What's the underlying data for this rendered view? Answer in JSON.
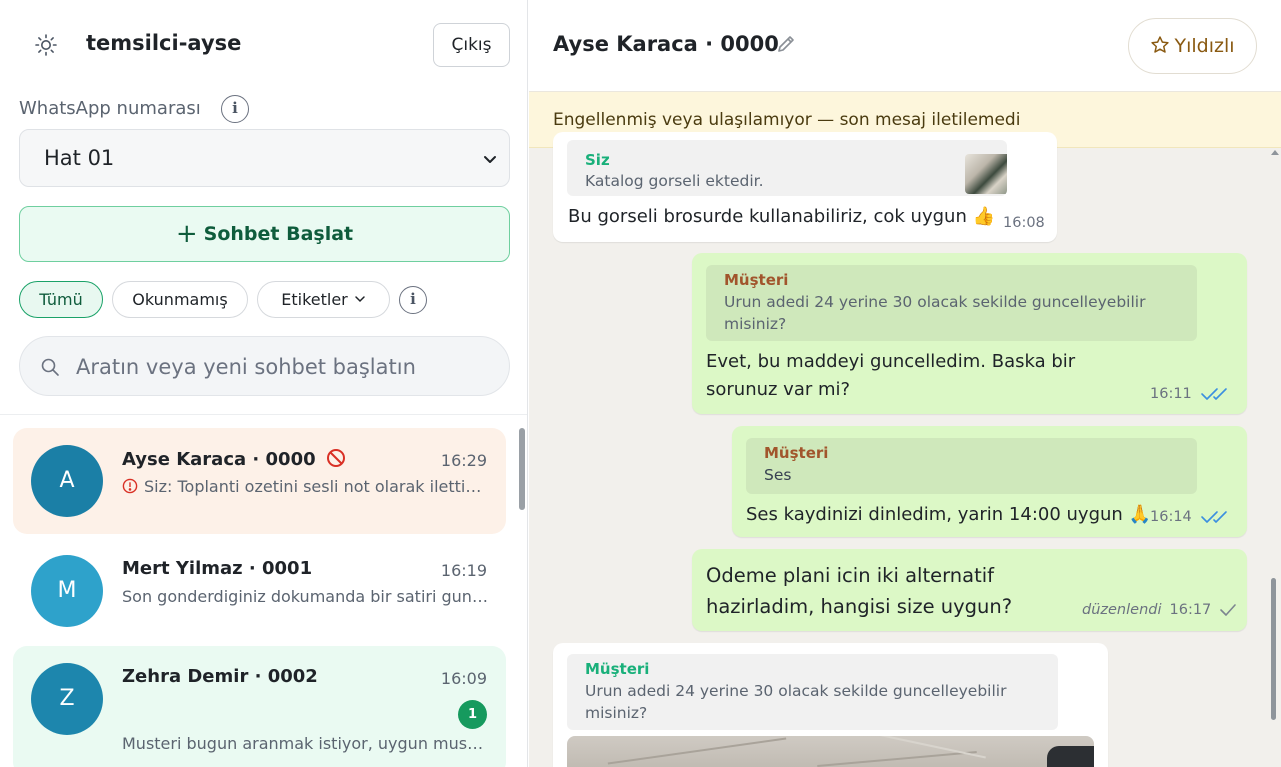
{
  "sidebar": {
    "agent_name": "temsilci-ayse",
    "logout_label": "Çıkış",
    "number_label": "WhatsApp numarası",
    "number_value": "Hat 01",
    "start_chat_label": "Sohbet Başlat",
    "filters": [
      {
        "label": "Tümü",
        "active": true
      },
      {
        "label": "Okunmamış",
        "active": false
      },
      {
        "label": "Etiketler",
        "active": false
      }
    ],
    "search_placeholder": "Aratın veya yeni sohbet başlatın",
    "conversations": [
      {
        "initial": "A",
        "name": "Ayse Karaca · 0000",
        "time": "16:29",
        "preview": "Siz: Toplanti ozetini sesli not olarak ilettim, dinleyebilir misiniz?",
        "blocked": true,
        "failed": true,
        "avatar_color": "#1b7fa6",
        "bg": "#fdf1e8"
      },
      {
        "initial": "M",
        "name": "Mert Yilmaz · 0001",
        "time": "16:19",
        "preview": "Son gonderdiginiz dokumanda bir satiri guncelleyebilir misiniz?",
        "avatar_color": "#2ea2cb",
        "bg": "#ffffff"
      },
      {
        "initial": "Z",
        "name": "Zehra Demir · 0002",
        "time": "16:09",
        "preview": "Musteri bugun aranmak istiyor, uygun musunuz?",
        "unread": "1",
        "avatar_color": "#1d86ad",
        "bg": "#eafaf2"
      }
    ]
  },
  "chat": {
    "title": "Ayse Karaca · 0000",
    "star_label": "Yıldızlı",
    "banner": "Engellenmiş veya ulaşılamıyor — son mesaj iletilemedi",
    "messages": [
      {
        "dir": "in",
        "quote_name": "Siz",
        "quote_text": "Katalog gorseli ektedir.",
        "text": "Bu gorseli brosurde kullanabiliriz, cok uygun 👍",
        "time": "16:08"
      },
      {
        "dir": "out",
        "quote_name": "Müşteri",
        "quote_text": "Urun adedi 24 yerine 30 olacak sekilde guncelleyebilir misiniz?",
        "text": "Evet, bu maddeyi guncelledim. Baska bir sorunuz var mi?",
        "time": "16:11",
        "status": "read"
      },
      {
        "dir": "out",
        "quote_name": "Müşteri",
        "quote_text": "Ses",
        "text": "Ses kaydinizi dinledim, yarin 14:00 uygun 🙏",
        "time": "16:14",
        "status": "read"
      },
      {
        "dir": "out",
        "text": "Odeme plani icin iki alternatif hazirladim, hangisi size uygun?",
        "edited": "düzenlendi",
        "time": "16:17",
        "status": "sent"
      },
      {
        "dir": "in",
        "quote_name": "Müşteri",
        "quote_text": "Urun adedi 24 yerine 30 olacak sekilde guncelleyebilir misiniz?",
        "has_image": true
      }
    ]
  },
  "colors": {
    "accent": "#1aa268",
    "incoming_bubble": "#ffffff",
    "outgoing_bubble": "#dcf8c6",
    "chat_bg": "#f2f0ec",
    "banner_bg": "#fdf6dc",
    "read_tick": "#3b8fe0"
  },
  "icons": [
    "sun-icon",
    "info-icon",
    "chevron-down-icon",
    "plus-icon",
    "search-icon",
    "blocked-icon",
    "error-icon",
    "pencil-icon",
    "star-icon",
    "double-check-icon",
    "single-check-icon"
  ]
}
